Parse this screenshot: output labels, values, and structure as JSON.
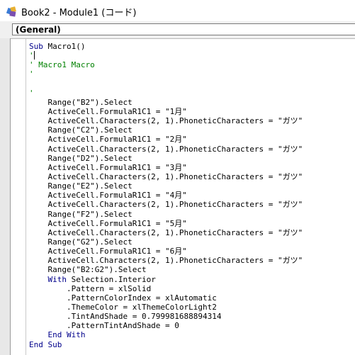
{
  "window": {
    "title": "Book2 - Module1 (コード)"
  },
  "object_combo": {
    "selected": "(General)"
  },
  "code_lines": [
    [
      {
        "t": "Sub",
        "c": "kw"
      },
      {
        "t": " Macro1()",
        "c": ""
      }
    ],
    [
      {
        "t": "'",
        "c": "cm"
      }
    ],
    [
      {
        "t": "' Macro1 Macro",
        "c": "cm"
      }
    ],
    [
      {
        "t": "'",
        "c": "cm"
      }
    ],
    [
      {
        "t": "",
        "c": ""
      }
    ],
    [
      {
        "t": "'",
        "c": "cm"
      }
    ],
    [
      {
        "t": "    Range(\"B2\").Select",
        "c": ""
      }
    ],
    [
      {
        "t": "    ActiveCell.FormulaR1C1 = \"1月\"",
        "c": ""
      }
    ],
    [
      {
        "t": "    ActiveCell.Characters(2, 1).PhoneticCharacters = \"ガツ\"",
        "c": ""
      }
    ],
    [
      {
        "t": "    Range(\"C2\").Select",
        "c": ""
      }
    ],
    [
      {
        "t": "    ActiveCell.FormulaR1C1 = \"2月\"",
        "c": ""
      }
    ],
    [
      {
        "t": "    ActiveCell.Characters(2, 1).PhoneticCharacters = \"ガツ\"",
        "c": ""
      }
    ],
    [
      {
        "t": "    Range(\"D2\").Select",
        "c": ""
      }
    ],
    [
      {
        "t": "    ActiveCell.FormulaR1C1 = \"3月\"",
        "c": ""
      }
    ],
    [
      {
        "t": "    ActiveCell.Characters(2, 1).PhoneticCharacters = \"ガツ\"",
        "c": ""
      }
    ],
    [
      {
        "t": "    Range(\"E2\").Select",
        "c": ""
      }
    ],
    [
      {
        "t": "    ActiveCell.FormulaR1C1 = \"4月\"",
        "c": ""
      }
    ],
    [
      {
        "t": "    ActiveCell.Characters(2, 1).PhoneticCharacters = \"ガツ\"",
        "c": ""
      }
    ],
    [
      {
        "t": "    Range(\"F2\").Select",
        "c": ""
      }
    ],
    [
      {
        "t": "    ActiveCell.FormulaR1C1 = \"5月\"",
        "c": ""
      }
    ],
    [
      {
        "t": "    ActiveCell.Characters(2, 1).PhoneticCharacters = \"ガツ\"",
        "c": ""
      }
    ],
    [
      {
        "t": "    Range(\"G2\").Select",
        "c": ""
      }
    ],
    [
      {
        "t": "    ActiveCell.FormulaR1C1 = \"6月\"",
        "c": ""
      }
    ],
    [
      {
        "t": "    ActiveCell.Characters(2, 1).PhoneticCharacters = \"ガツ\"",
        "c": ""
      }
    ],
    [
      {
        "t": "    Range(\"B2:G2\").Select",
        "c": ""
      }
    ],
    [
      {
        "t": "    ",
        "c": ""
      },
      {
        "t": "With",
        "c": "kw"
      },
      {
        "t": " Selection.Interior",
        "c": ""
      }
    ],
    [
      {
        "t": "        .Pattern = xlSolid",
        "c": ""
      }
    ],
    [
      {
        "t": "        .PatternColorIndex = xlAutomatic",
        "c": ""
      }
    ],
    [
      {
        "t": "        .ThemeColor = xlThemeColorLight2",
        "c": ""
      }
    ],
    [
      {
        "t": "        .TintAndShade = 0.799981688894314",
        "c": ""
      }
    ],
    [
      {
        "t": "        .PatternTintAndShade = 0",
        "c": ""
      }
    ],
    [
      {
        "t": "    ",
        "c": ""
      },
      {
        "t": "End With",
        "c": "kw"
      }
    ],
    [
      {
        "t": "End Sub",
        "c": "kw"
      }
    ]
  ],
  "icons": {
    "app": "vba-editor-icon"
  },
  "colors": {
    "keyword": "#00008b",
    "comment": "#008000"
  }
}
